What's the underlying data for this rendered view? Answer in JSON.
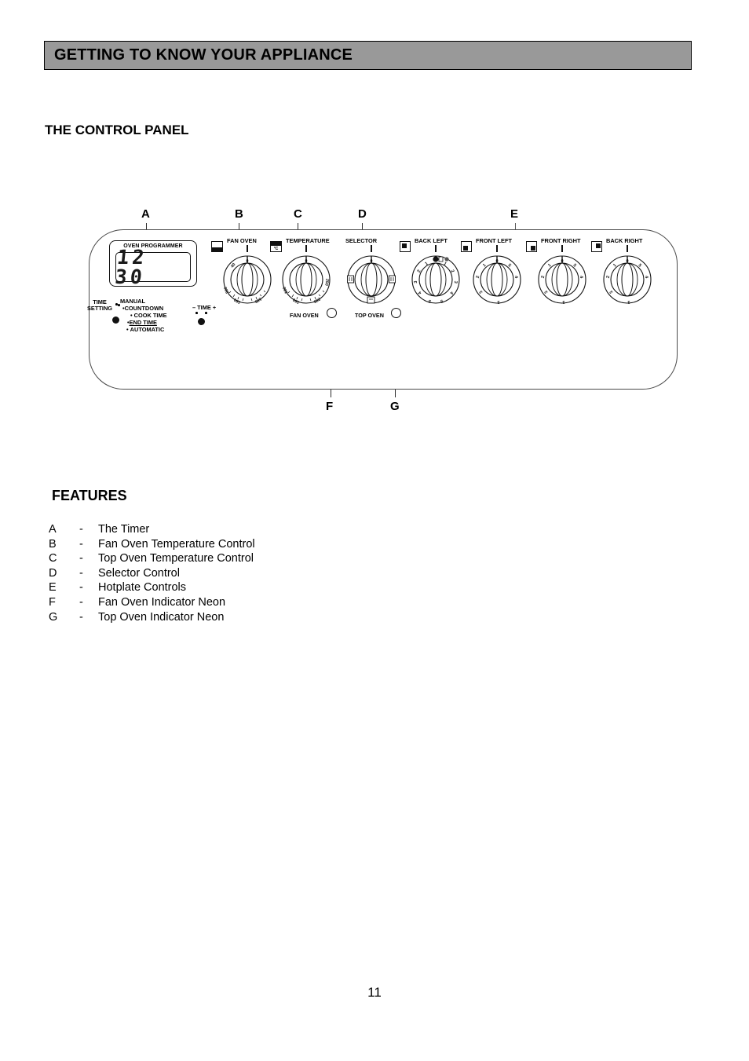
{
  "banner": {
    "title": "GETTING TO KNOW YOUR APPLIANCE"
  },
  "sections": {
    "control_panel_heading": "THE CONTROL PANEL",
    "features_heading": "FEATURES"
  },
  "callouts": [
    {
      "letter": "A",
      "target": "timer"
    },
    {
      "letter": "B",
      "target": "fan-oven-temperature-control"
    },
    {
      "letter": "C",
      "target": "top-oven-temperature-control"
    },
    {
      "letter": "D",
      "target": "selector-control"
    },
    {
      "letter": "E",
      "target": "hotplate-controls"
    },
    {
      "letter": "F",
      "target": "fan-oven-indicator-neon"
    },
    {
      "letter": "G",
      "target": "top-oven-indicator-neon"
    }
  ],
  "timer": {
    "caption": "OVEN PROGRAMMER",
    "display_value": "12 30",
    "legend": {
      "time_setting_line1": "TIME",
      "time_setting_line2": "SETTING",
      "manual": "MANUAL",
      "countdown": "COUNTDOWN",
      "cook_time": "COOK TIME",
      "end_time": "END TIME",
      "automatic": "AUTOMATIC",
      "time_minus_plus": "– TIME +"
    }
  },
  "knobs": [
    {
      "id": "fan-oven",
      "label": "FAN OVEN",
      "icon": "oven-fan-icon",
      "scale": "temperature",
      "ticks": [
        "0",
        "40",
        "100",
        "150",
        "200",
        "250"
      ],
      "selected": "0"
    },
    {
      "id": "temperature",
      "label": "TEMPERATURE",
      "icon": "oven-temperature-icon",
      "icon_text": "°C",
      "scale": "temperature",
      "ticks": [
        "0",
        "100",
        "150",
        "200",
        "250"
      ],
      "selected": "0"
    },
    {
      "id": "selector",
      "label": "SELECTOR",
      "icon": "none",
      "scale": "selector",
      "ticks": [
        "0"
      ],
      "selected": "0"
    },
    {
      "id": "back-left",
      "label": "BACK LEFT",
      "icon": "hob-back-left-icon",
      "scale": "hotplate",
      "ticks": [
        "0",
        "1",
        "2",
        "3",
        "4",
        "5"
      ],
      "selected": "0"
    },
    {
      "id": "front-left",
      "label": "FRONT LEFT",
      "icon": "hob-front-left-icon",
      "scale": "hotplate",
      "ticks": [
        "0",
        "1",
        "2",
        "3",
        "4",
        "5"
      ],
      "selected": "0"
    },
    {
      "id": "front-right",
      "label": "FRONT RIGHT",
      "icon": "hob-front-right-icon",
      "scale": "hotplate",
      "ticks": [
        "0",
        "1",
        "2",
        "3",
        "4",
        "5"
      ],
      "selected": "0"
    },
    {
      "id": "back-right",
      "label": "BACK RIGHT",
      "icon": "hob-back-right-icon",
      "scale": "hotplate",
      "ticks": [
        "0",
        "1",
        "2",
        "3",
        "4",
        "5"
      ],
      "selected": "0"
    }
  ],
  "neons": [
    {
      "id": "fan-oven-neon",
      "label": "FAN OVEN"
    },
    {
      "id": "top-oven-neon",
      "label": "TOP OVEN"
    }
  ],
  "features": [
    {
      "key": "A",
      "dash": "-",
      "label": "The Timer"
    },
    {
      "key": "B",
      "dash": "-",
      "label": "Fan Oven Temperature Control"
    },
    {
      "key": "C",
      "dash": "-",
      "label": "Top Oven Temperature Control"
    },
    {
      "key": "D",
      "dash": "-",
      "label": "Selector Control"
    },
    {
      "key": "E",
      "dash": "-",
      "label": "Hotplate Controls"
    },
    {
      "key": "F",
      "dash": "-",
      "label": "Fan Oven Indicator Neon"
    },
    {
      "key": "G",
      "dash": "-",
      "label": "Top Oven Indicator Neon"
    }
  ],
  "page_number": "11",
  "colors": {
    "banner_bg": "#999999",
    "ink": "#000000",
    "outline": "#4a4a4a"
  }
}
